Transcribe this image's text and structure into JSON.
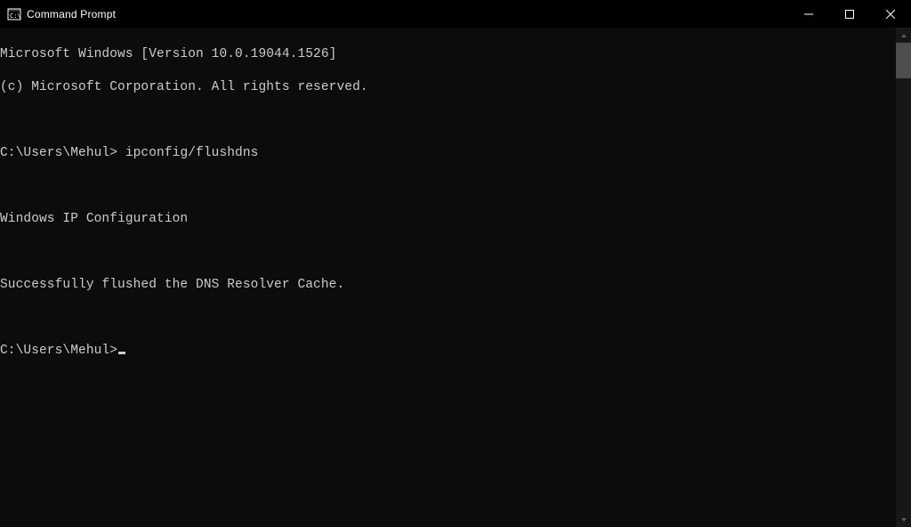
{
  "titlebar": {
    "title": "Command Prompt"
  },
  "console": {
    "line1": "Microsoft Windows [Version 10.0.19044.1526]",
    "line2": "(c) Microsoft Corporation. All rights reserved.",
    "prompt1": "C:\\Users\\Mehul>",
    "command1": " ipconfig/flushdns",
    "heading": "Windows IP Configuration",
    "result": "Successfully flushed the DNS Resolver Cache.",
    "prompt2": "C:\\Users\\Mehul>"
  }
}
